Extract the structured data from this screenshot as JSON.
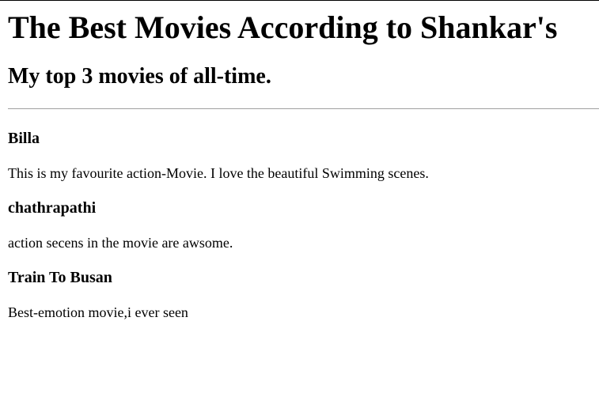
{
  "page": {
    "title": "The Best Movies According to Shankar's",
    "subtitle": "My top 3 movies of all-time."
  },
  "movies": [
    {
      "name": "Billa",
      "description": "This is my favourite action-Movie. I love the beautiful Swimming scenes."
    },
    {
      "name": "chathrapathi",
      "description": "action secens in the movie are awsome."
    },
    {
      "name": "Train To Busan",
      "description": "Best-emotion movie,i ever seen"
    }
  ]
}
